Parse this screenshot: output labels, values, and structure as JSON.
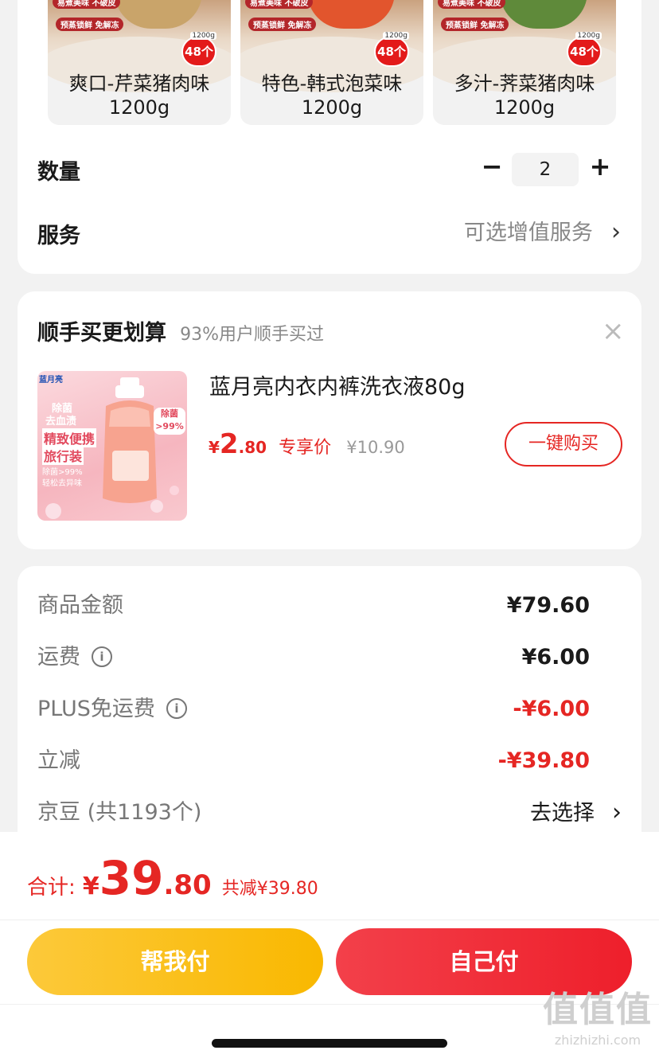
{
  "variants": [
    {
      "tag1": "易煮美味 不破皮",
      "tag2": "预蒸锁鲜 免解冻",
      "weight_tag": "1200g",
      "count": "48个",
      "label": "爽口-芹菜猪肉味",
      "weight": "1200g",
      "filling_color": "#c9a46a"
    },
    {
      "tag1": "易煮美味 不破皮",
      "tag2": "预蒸锁鲜 免解冻",
      "weight_tag": "1200g",
      "count": "48个",
      "label": "特色-韩式泡菜味",
      "weight": "1200g",
      "filling_color": "#e2552d"
    },
    {
      "tag1": "易煮美味 不破皮",
      "tag2": "预蒸锁鲜 免解冻",
      "weight_tag": "1200g",
      "count": "48个",
      "label": "多汁-荠菜猪肉味",
      "weight": "1200g",
      "filling_color": "#5f8a3a"
    }
  ],
  "quantity": {
    "label": "数量",
    "minus": "−",
    "value": "2",
    "plus": "+"
  },
  "service": {
    "label": "服务",
    "value": "可选增值服务",
    "chevron": "›"
  },
  "addon": {
    "title": "顺手买更划算",
    "subtitle": "93%用户顺手买过",
    "close": "×",
    "product": {
      "name": "蓝月亮内衣内裤洗衣液80g",
      "currency": "¥",
      "price_int": "2",
      "price_dec": ".80",
      "price_note": "专享价",
      "original_price": "¥10.90",
      "buy_button": "一键购买",
      "image_texts": {
        "brand": "蓝月亮",
        "l1": "除菌",
        "l2": "去血渍",
        "l3": "精致便携",
        "l4": "旅行装",
        "l5": "除菌>99%",
        "l6": "轻松去异味",
        "badge1": "除菌",
        "badge2": ">99%"
      }
    }
  },
  "summary": [
    {
      "label": "商品金额",
      "value": "¥79.60",
      "info": false,
      "red": false
    },
    {
      "label": "运费",
      "value": "¥6.00",
      "info": true,
      "red": false
    },
    {
      "label": "PLUS免运费",
      "value": "-¥6.00",
      "info": true,
      "red": true
    },
    {
      "label": "立减",
      "value": "-¥39.80",
      "info": false,
      "red": true
    },
    {
      "label": "京豆 (共1193个)",
      "value": "去选择",
      "info": false,
      "red": false,
      "chevron": "›"
    }
  ],
  "footer": {
    "total_label": "合计:",
    "currency": "¥",
    "total_int": "39",
    "total_dec": ".80",
    "discount": "共减¥39.80",
    "help_pay": "帮我付",
    "self_pay": "自己付"
  },
  "watermark": {
    "logo": "值值值",
    "site": "zhizhizhi.com"
  },
  "colors": {
    "accent_red": "#e52623",
    "pay_red": "#f2353d",
    "pay_yellow": "#fbc21a",
    "page_bg": "#f2f2f2"
  }
}
